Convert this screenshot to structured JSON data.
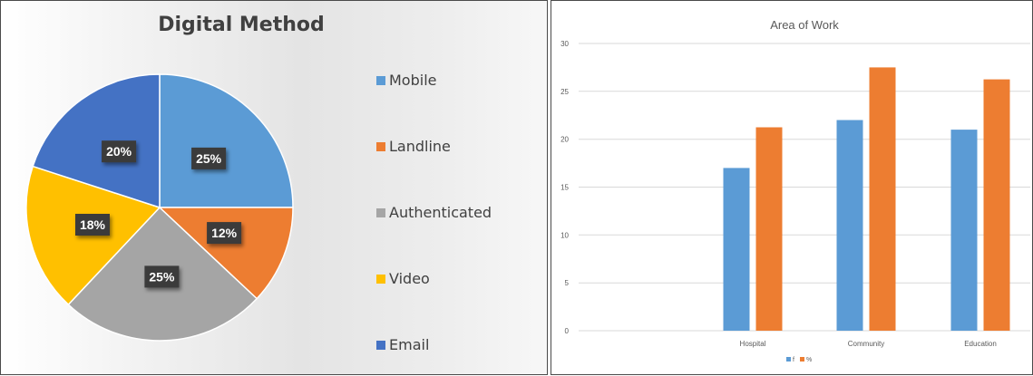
{
  "chart_data": [
    {
      "type": "pie",
      "title": "Digital Method",
      "categories": [
        "Mobile",
        "Landline",
        "Authenticated",
        "Video",
        "Email"
      ],
      "values": [
        25,
        12,
        25,
        18,
        20
      ],
      "labels": [
        "25%",
        "12%",
        "25%",
        "18%",
        "20%"
      ],
      "colors": [
        "#5b9bd5",
        "#ed7d31",
        "#a5a5a5",
        "#ffc000",
        "#4472c4"
      ],
      "legend_position": "right"
    },
    {
      "type": "bar",
      "title": "Area of Work",
      "categories": [
        "Hospital",
        "Community",
        "Education"
      ],
      "series": [
        {
          "name": "f",
          "values": [
            17,
            22,
            21
          ],
          "color": "#5b9bd5"
        },
        {
          "name": "%",
          "values": [
            21.25,
            27.5,
            26.25
          ],
          "color": "#ed7d31"
        }
      ],
      "ylim": [
        0,
        30
      ],
      "yticks": [
        "0",
        "5",
        "10",
        "15",
        "20",
        "25",
        "30"
      ],
      "grid": true,
      "legend_position": "bottom"
    }
  ]
}
